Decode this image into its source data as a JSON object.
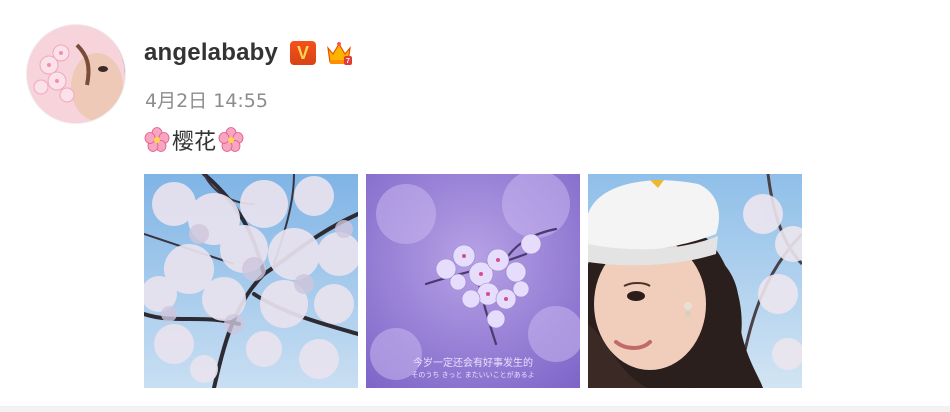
{
  "post": {
    "username": "angelababy",
    "verified_badge": "V",
    "timestamp": "4月2日 14:55",
    "text": "樱花",
    "text_emoji": "cherry-blossom-icon",
    "photos": [
      {
        "name": "cherry-blossom-tree-photo"
      },
      {
        "name": "purple-cherry-blossom-photo",
        "caption_cn": "今岁一定还会有好事发生的",
        "caption_jp": "そのうち きっと またいいことがあるよ"
      },
      {
        "name": "selfie-white-cap-photo"
      }
    ]
  },
  "colors": {
    "username": "#333333",
    "timestamp": "#8c8c8c",
    "verified_badge_bg": "#e64a19",
    "verified_badge_text": "#ffd54f",
    "divider": "#f2f2f2"
  }
}
